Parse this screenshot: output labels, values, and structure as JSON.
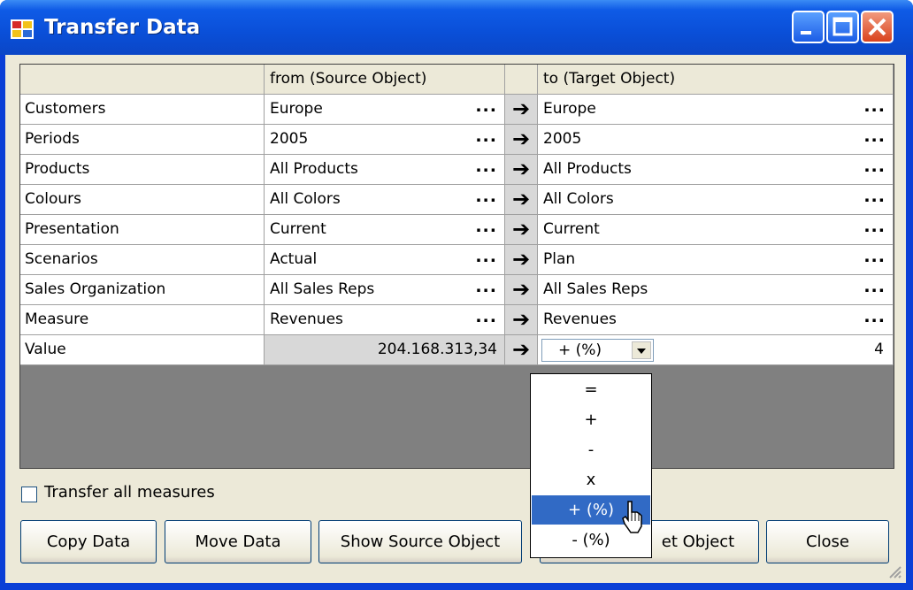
{
  "window": {
    "title": "Transfer Data"
  },
  "headers": {
    "source": "from (Source Object)",
    "target": "to (Target Object)"
  },
  "rows": [
    {
      "label": "Customers",
      "source": "Europe",
      "target": "Europe"
    },
    {
      "label": "Periods",
      "source": "2005",
      "target": "2005"
    },
    {
      "label": "Products",
      "source": "All Products",
      "target": "All Products"
    },
    {
      "label": "Colours",
      "source": "All Colors",
      "target": "All Colors"
    },
    {
      "label": "Presentation",
      "source": "Current",
      "target": "Current"
    },
    {
      "label": "Scenarios",
      "source": "Actual",
      "target": "Plan"
    },
    {
      "label": "Sales Organization",
      "source": "All Sales Reps",
      "target": "All Sales Reps"
    },
    {
      "label": "Measure",
      "source": "Revenues",
      "target": "Revenues"
    }
  ],
  "value_row": {
    "label": "Value",
    "source": "204.168.313,34",
    "operation": "+ (%)",
    "target_value": "4"
  },
  "ellipsis": "...",
  "arrow": "➔",
  "operation_options": [
    "=",
    "+",
    "-",
    "x",
    "+ (%)",
    "- (%)"
  ],
  "selected_option": "+ (%)",
  "transfer_all": {
    "label": "Transfer all measures",
    "checked": false
  },
  "buttons": {
    "copy": "Copy Data",
    "move": "Move Data",
    "show_source": "Show Source Object",
    "show_target_partial": "et Object",
    "close": "Close"
  }
}
